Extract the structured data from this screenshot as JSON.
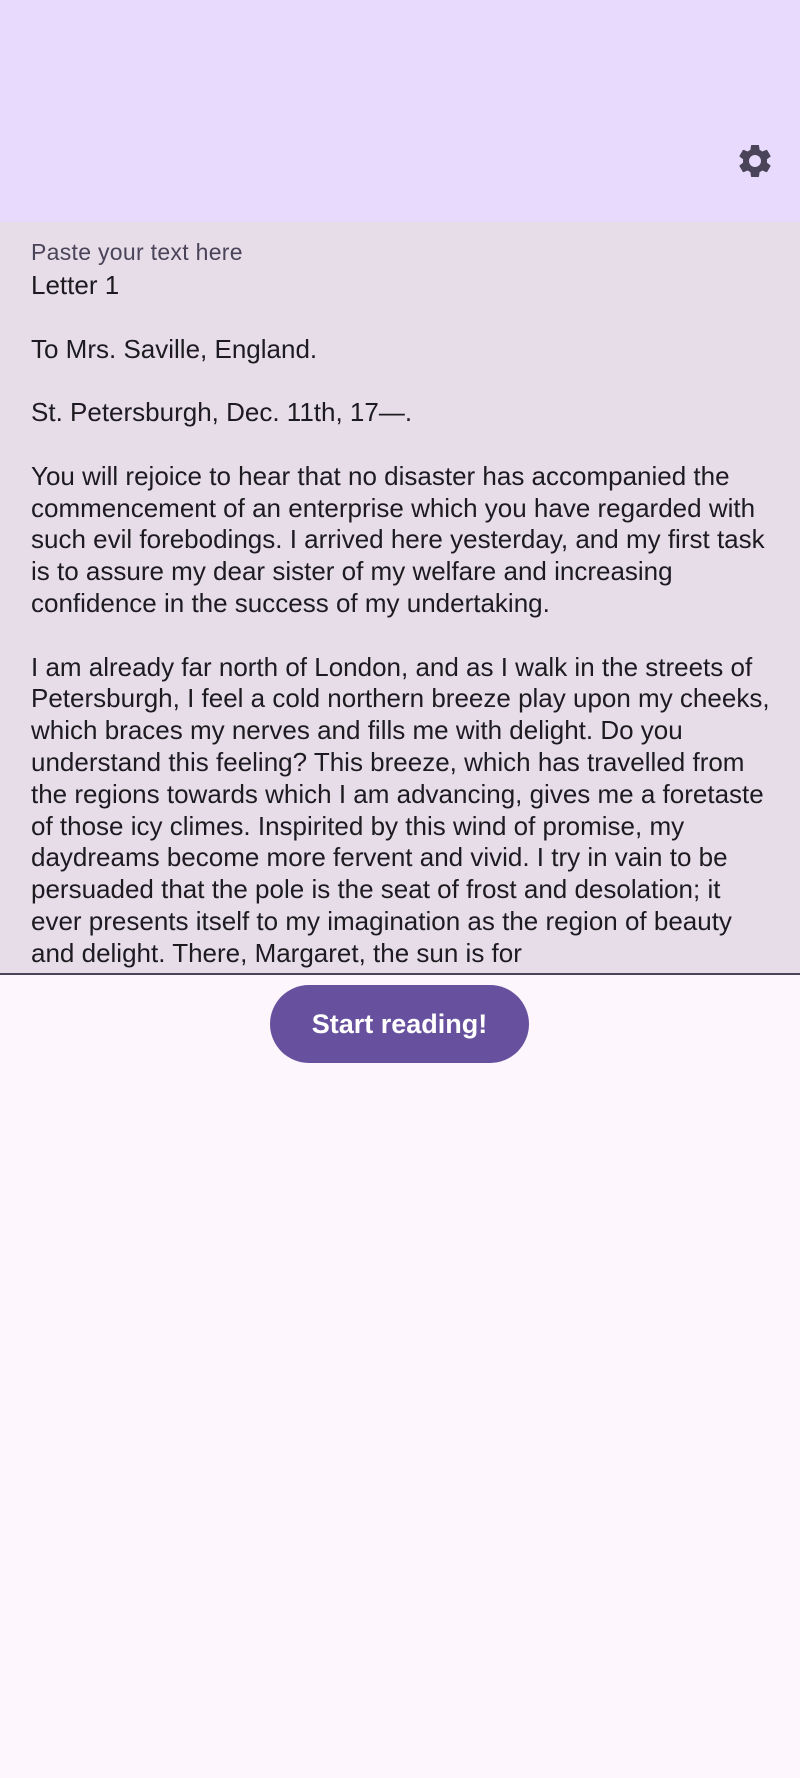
{
  "app_bar": {
    "settings_icon": "gear-icon"
  },
  "text_field": {
    "label": "Paste your text here",
    "value": "Letter 1\n\nTo Mrs. Saville, England.\n\nSt. Petersburgh, Dec. 11th, 17—.\n\nYou will rejoice to hear that no disaster has accompanied the commencement of an enterprise which you have regarded with such evil forebodings. I arrived here yesterday, and my first task is to assure my dear sister of my welfare and increasing confidence in the success of my undertaking.\n\nI am already far north of London, and as I walk in the streets of Petersburgh, I feel a cold northern breeze play upon my cheeks, which braces my nerves and fills me with delight. Do you understand this feeling? This breeze, which has travelled from the regions towards which I am advancing, gives me a foretaste of those icy climes. Inspirited by this wind of promise, my daydreams become more fervent and vivid. I try in vain to be persuaded that the pole is the seat of frost and desolation; it ever presents itself to my imagination as the region of beauty and delight. There, Margaret, the sun is for"
  },
  "start_button": {
    "label": "Start reading!"
  },
  "colors": {
    "app_bar_bg": "#e8dafd",
    "field_bg": "#e6dde9",
    "page_bg": "#fdf7fd",
    "primary": "#67519f",
    "icon": "#4a4458"
  }
}
